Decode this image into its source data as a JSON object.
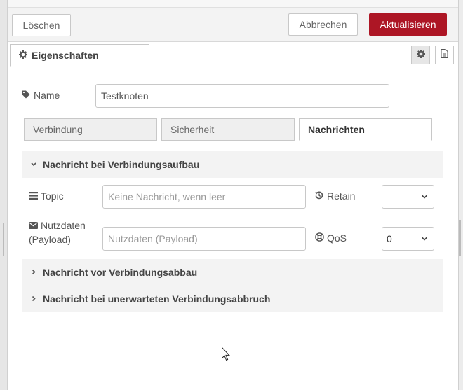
{
  "header": {
    "delete_label": "Löschen",
    "cancel_label": "Abbrechen",
    "update_label": "Aktualisieren"
  },
  "tabs": {
    "properties_label": "Eigenschaften",
    "properties_icon": "gear-icon",
    "settings_icon": "gear-icon",
    "description_icon": "document-icon"
  },
  "name": {
    "label": "Name",
    "icon": "tag-icon",
    "value": "Testknoten"
  },
  "subtabs": [
    {
      "label": "Verbindung",
      "active": false
    },
    {
      "label": "Sicherheit",
      "active": false
    },
    {
      "label": "Nachrichten",
      "active": true
    }
  ],
  "sections": [
    {
      "title": "Nachricht bei Verbindungsaufbau",
      "expanded": true
    },
    {
      "title": "Nachricht vor Verbindungsabbau",
      "expanded": false
    },
    {
      "title": "Nachricht bei unerwarteten Verbindungsabbruch",
      "expanded": false
    }
  ],
  "birth_message": {
    "topic_label": "Topic",
    "topic_icon": "list-icon",
    "topic_placeholder": "Keine Nachricht, wenn leer",
    "retain_label": "Retain",
    "retain_icon": "history-icon",
    "retain_value": "",
    "payload_label_line1": "Nutzdaten",
    "payload_label_line2": "(Payload)",
    "payload_icon": "envelope-icon",
    "payload_placeholder": "Nutzdaten (Payload)",
    "qos_label": "QoS",
    "qos_icon": "support-icon",
    "qos_value": "0"
  },
  "colors": {
    "primary": "#ad1625",
    "section_bg": "#f3f3f3",
    "border": "#c8c8c8"
  }
}
